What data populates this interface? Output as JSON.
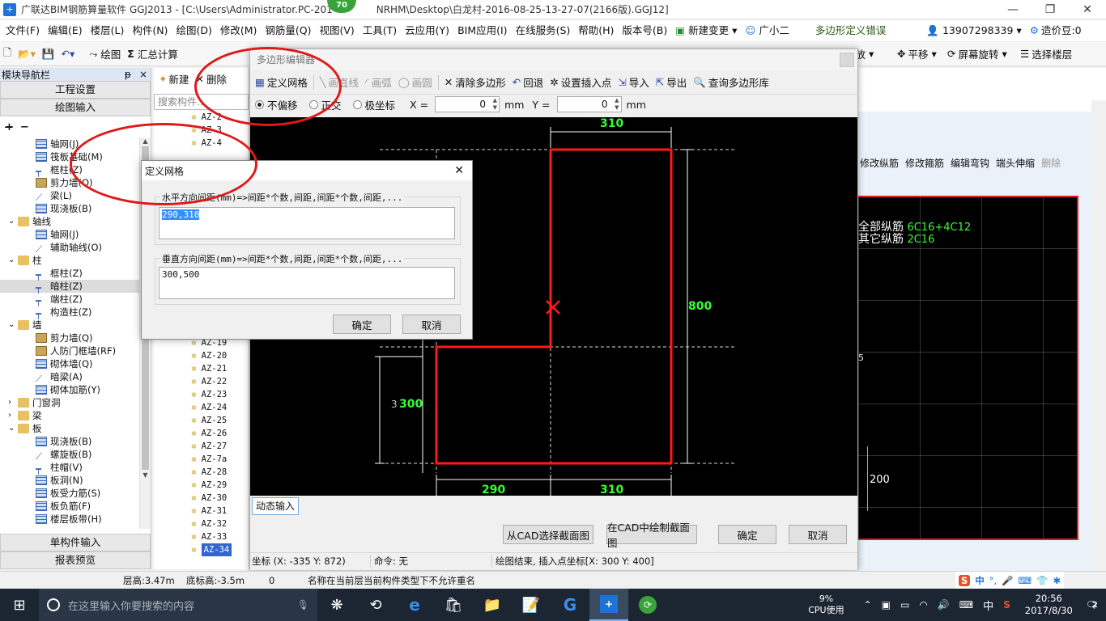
{
  "window": {
    "title": "广联达BIM钢筋算量软件 GGJ2013 - [C:\\Users\\Administrator.PC-201",
    "title_tail": "NRHM\\Desktop\\白龙村-2016-08-25-13-27-07(2166版).GGJ12]",
    "badge": "70",
    "minimize": "—",
    "restore": "❐",
    "close": "✕"
  },
  "menu": {
    "items": [
      "文件(F)",
      "编辑(E)",
      "楼层(L)",
      "构件(N)",
      "绘图(D)",
      "修改(M)",
      "钢筋量(Q)",
      "视图(V)",
      "工具(T)",
      "云应用(Y)",
      "BIM应用(I)",
      "在线服务(S)",
      "帮助(H)",
      "版本号(B)"
    ],
    "new_change": "新建变更",
    "assistant": "广小二",
    "error_notice": "多边形定义错误",
    "phone": "13907298339",
    "price_bean": "造价豆:0"
  },
  "toolbar": {
    "draw": "绘图",
    "summary": "汇总计算",
    "zoom": "缩放",
    "pan": "平移",
    "rotate": "屏幕旋转",
    "select_floor": "选择楼层"
  },
  "nav": {
    "title": "模块导航栏",
    "pin": "ᵽ",
    "close": "×",
    "project_settings": "工程设置",
    "drawing_input": "绘图输入",
    "single_input": "单构件输入",
    "report_preview": "报表预览",
    "tree": [
      {
        "label": "轴网(J)",
        "level": 2,
        "icon": "grid"
      },
      {
        "label": "筏板基础(M)",
        "level": 2,
        "icon": "grid"
      },
      {
        "label": "框柱(Z)",
        "level": 2,
        "icon": "col"
      },
      {
        "label": "剪力墙(Q)",
        "level": 2,
        "icon": "wall"
      },
      {
        "label": "梁(L)",
        "level": 2,
        "icon": "beam"
      },
      {
        "label": "现浇板(B)",
        "level": 2,
        "icon": "grid"
      },
      {
        "label": "轴线",
        "level": 1,
        "icon": "folder",
        "toggle": "⌄"
      },
      {
        "label": "轴网(J)",
        "level": 2,
        "icon": "grid"
      },
      {
        "label": "辅助轴线(O)",
        "level": 2,
        "icon": "beam"
      },
      {
        "label": "柱",
        "level": 1,
        "icon": "folder",
        "toggle": "⌄"
      },
      {
        "label": "框柱(Z)",
        "level": 2,
        "icon": "col"
      },
      {
        "label": "暗柱(Z)",
        "level": 2,
        "icon": "col"
      },
      {
        "label": "端柱(Z)",
        "level": 2,
        "icon": "col"
      },
      {
        "label": "构造柱(Z)",
        "level": 2,
        "icon": "col"
      },
      {
        "label": "墙",
        "level": 1,
        "icon": "folder",
        "toggle": "⌄"
      },
      {
        "label": "剪力墙(Q)",
        "level": 2,
        "icon": "wall"
      },
      {
        "label": "人防门框墙(RF)",
        "level": 2,
        "icon": "wall"
      },
      {
        "label": "砌体墙(Q)",
        "level": 2,
        "icon": "grid"
      },
      {
        "label": "暗梁(A)",
        "level": 2,
        "icon": "beam"
      },
      {
        "label": "砌体加筋(Y)",
        "level": 2,
        "icon": "grid"
      },
      {
        "label": "门窗洞",
        "level": 1,
        "icon": "folder",
        "toggle": "›"
      },
      {
        "label": "梁",
        "level": 1,
        "icon": "folder",
        "toggle": "›"
      },
      {
        "label": "板",
        "level": 1,
        "icon": "folder",
        "toggle": "⌄"
      },
      {
        "label": "现浇板(B)",
        "level": 2,
        "icon": "grid"
      },
      {
        "label": "螺旋板(B)",
        "level": 2,
        "icon": "beam"
      },
      {
        "label": "柱帽(V)",
        "level": 2,
        "icon": "col"
      },
      {
        "label": "板洞(N)",
        "level": 2,
        "icon": "grid"
      },
      {
        "label": "板受力筋(S)",
        "level": 2,
        "icon": "grid"
      },
      {
        "label": "板负筋(F)",
        "level": 2,
        "icon": "grid"
      },
      {
        "label": "楼层板带(H)",
        "level": 2,
        "icon": "grid"
      }
    ]
  },
  "components": {
    "new": "新建",
    "delete": "删除",
    "search_placeholder": "搜索构件...",
    "top_items": [
      "AZ-2",
      "AZ-3",
      "AZ-4"
    ],
    "items": [
      "AZ-19",
      "AZ-20",
      "AZ-21",
      "AZ-22",
      "AZ-23",
      "AZ-24",
      "AZ-25",
      "AZ-26",
      "AZ-27",
      "AZ-7a",
      "AZ-28",
      "AZ-29",
      "AZ-30",
      "AZ-31",
      "AZ-32",
      "AZ-33",
      "AZ-34"
    ]
  },
  "right_panel": {
    "toolbar": [
      "修改纵筋",
      "修改箍筋",
      "编辑弯钩",
      "端头伸缩",
      "删除"
    ],
    "all_rebar_label": "全部纵筋",
    "all_rebar_value": "6C16+4C12",
    "other_rebar_label": "其它纵筋",
    "other_rebar_value": "2C16",
    "dim_200": "200",
    "dim_5": "5"
  },
  "poly_editor": {
    "title": "多边形编辑器",
    "tools": {
      "define_grid": "定义网格",
      "draw_line": "画直线",
      "draw_arc": "画弧",
      "draw_circle": "画圆",
      "clear_polygon": "清除多边形",
      "undo": "回退",
      "set_insert_point": "设置插入点",
      "import": "导入",
      "export": "导出",
      "query_library": "查询多边形库"
    },
    "coord": {
      "no_offset": "不偏移",
      "ortho": "正交",
      "polar": "极坐标",
      "x_label": "X =",
      "x_value": "0",
      "y_label": "Y =",
      "y_value": "0",
      "unit": "mm"
    },
    "dims": {
      "top_310": "310",
      "right_800": "800",
      "left_300": "300",
      "left_3": "3",
      "bottom_290": "290",
      "bottom_310": "310"
    },
    "dynamic_input": "动态输入",
    "from_cad": "从CAD选择截面图",
    "draw_in_cad": "在CAD中绘制截面图",
    "ok": "确定",
    "cancel": "取消",
    "status_coord": "坐标 (X: -335 Y: 872)",
    "status_cmd": "命令: 无",
    "status_msg": "绘图结束, 插入点坐标[X: 300 Y: 400]"
  },
  "grid_dialog": {
    "title": "定义网格",
    "close": "✕",
    "h_label": "水平方向间距(mm)=>间距*个数,间距,间距*个数,间距,...",
    "h_value": "290,310",
    "v_label": "垂直方向间距(mm)=>间距*个数,间距,间距*个数,间距,...",
    "v_value": "300,500",
    "ok": "确定",
    "cancel": "取消"
  },
  "status": {
    "floor_height": "层高:3.47m",
    "bottom_height": "底标高:-3.5m",
    "zero": "0",
    "message": "名称在当前层当前构件类型下不允许重名"
  },
  "taskbar": {
    "search_placeholder": "在这里输入你要搜索的内容",
    "cpu_percent": "9%",
    "cpu_label": "CPU使用",
    "ime": "中",
    "time": "20:56",
    "date": "2017/8/30",
    "notif_count": "2",
    "tray_ime_label": "中"
  },
  "colors": {
    "polygon_red": "#ff1a1a",
    "dim_green": "#33ff33",
    "accent_blue": "#1e73d8",
    "annotation_red": "#e01818"
  }
}
